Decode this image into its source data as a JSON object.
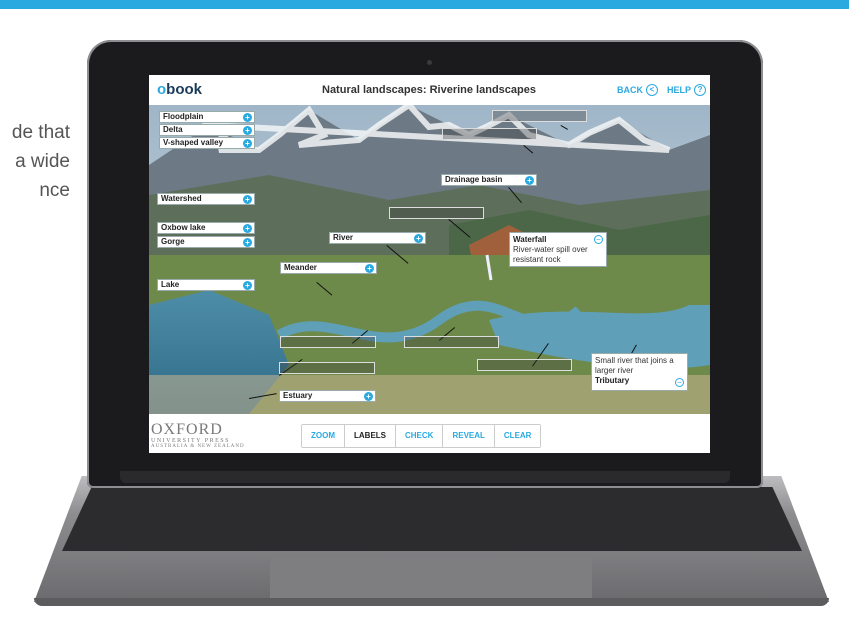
{
  "side_text": [
    "de that",
    "a wide",
    "nce"
  ],
  "app": {
    "logo_o": "o",
    "logo_rest": "book",
    "title": "Natural landscapes: Riverine landscapes",
    "back_label": "BACK",
    "help_label": "HELP"
  },
  "labels": {
    "floodplain": "Floodplain",
    "delta": "Delta",
    "v_shaped_valley": "V-shaped valley",
    "watershed": "Watershed",
    "oxbow_lake": "Oxbow lake",
    "gorge": "Gorge",
    "lake": "Lake",
    "drainage_basin": "Drainage basin",
    "river": "River",
    "meander": "Meander",
    "estuary": "Estuary"
  },
  "waterfall": {
    "title": "Waterfall",
    "desc": "River-water spill over resistant rock"
  },
  "tributary": {
    "title": "Tributary",
    "desc": "Small river that joins a larger river"
  },
  "icons": {
    "plus": "+",
    "minus": "−",
    "back": "<",
    "help": "?"
  },
  "publisher": {
    "line1": "OXFORD",
    "line2": "UNIVERSITY PRESS",
    "line3": "AUSTRALIA & NEW ZEALAND"
  },
  "toolbar": [
    "ZOOM",
    "LABELS",
    "CHECK",
    "REVEAL",
    "CLEAR"
  ],
  "colors": {
    "accent": "#2aa9e0",
    "brand": "#1a3b5a"
  }
}
